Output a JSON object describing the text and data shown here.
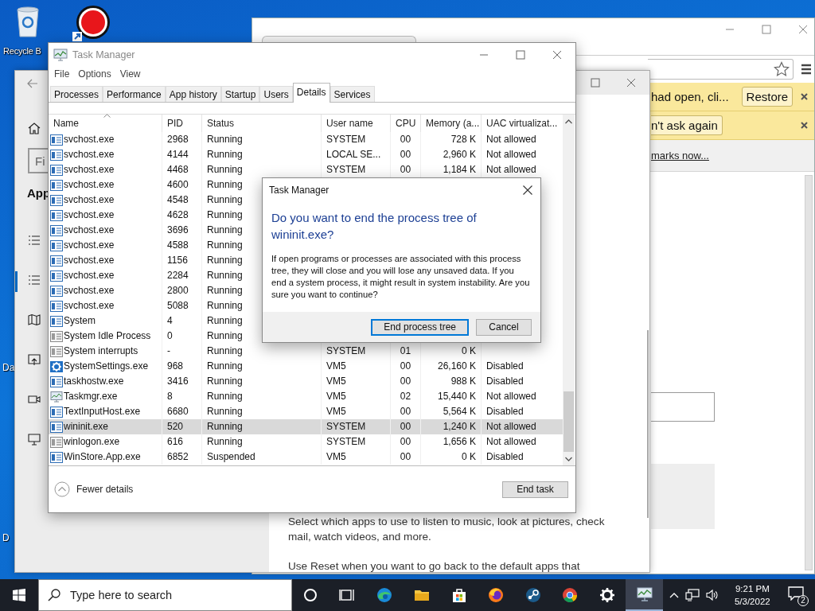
{
  "desktop": {
    "recycle_bin": {
      "label": "Recycle B"
    },
    "edge_labels": [
      "Da",
      "D"
    ]
  },
  "browser": {
    "infobars": [
      {
        "text": "had open, cli...",
        "button": "Restore"
      },
      {
        "button": "n't ask again"
      }
    ],
    "bookmark_link": "marks now..."
  },
  "settings": {
    "search": {
      "placeholder": "Fi"
    },
    "heading": "App",
    "nav": [
      {
        "kind": "list",
        "selected": false
      },
      {
        "kind": "list",
        "selected": true
      },
      {
        "kind": "map",
        "selected": false
      },
      {
        "kind": "open",
        "selected": false
      },
      {
        "kind": "video",
        "selected": false
      },
      {
        "kind": "display",
        "selected": false
      }
    ],
    "paragraphs": [
      "Select which apps to use to listen to music, look at pictures, check mail, watch videos, and more.",
      "Use Reset when you want to go back to the default apps that"
    ]
  },
  "task_manager": {
    "title": "Task Manager",
    "menu": [
      "File",
      "Options",
      "View"
    ],
    "tabs": [
      {
        "label": "Processes",
        "selected": false
      },
      {
        "label": "Performance",
        "selected": false
      },
      {
        "label": "App history",
        "selected": false
      },
      {
        "label": "Startup",
        "selected": false
      },
      {
        "label": "Users",
        "selected": false
      },
      {
        "label": "Details",
        "selected": true
      },
      {
        "label": "Services",
        "selected": false
      }
    ],
    "columns": [
      "Name",
      "PID",
      "Status",
      "User name",
      "CPU",
      "Memory (a...",
      "UAC virtualizat..."
    ],
    "rows": [
      {
        "kind": "app",
        "name": "svchost.exe",
        "pid": "2968",
        "status": "Running",
        "user": "SYSTEM",
        "cpu": "00",
        "memory": "728 K",
        "uac": "Not allowed",
        "selected": false
      },
      {
        "kind": "app",
        "name": "svchost.exe",
        "pid": "4144",
        "status": "Running",
        "user": "LOCAL SE...",
        "cpu": "00",
        "memory": "2,960 K",
        "uac": "Not allowed",
        "selected": false
      },
      {
        "kind": "app",
        "name": "svchost.exe",
        "pid": "4468",
        "status": "Running",
        "user": "SYSTEM",
        "cpu": "00",
        "memory": "1,184 K",
        "uac": "Not allowed",
        "selected": false
      },
      {
        "kind": "app",
        "name": "svchost.exe",
        "pid": "4600",
        "status": "Running",
        "selected": false
      },
      {
        "kind": "app",
        "name": "svchost.exe",
        "pid": "4548",
        "status": "Running",
        "selected": false
      },
      {
        "kind": "app",
        "name": "svchost.exe",
        "pid": "4628",
        "status": "Running",
        "selected": false
      },
      {
        "kind": "app",
        "name": "svchost.exe",
        "pid": "3696",
        "status": "Running",
        "selected": false
      },
      {
        "kind": "app",
        "name": "svchost.exe",
        "pid": "4588",
        "status": "Running",
        "selected": false
      },
      {
        "kind": "app",
        "name": "svchost.exe",
        "pid": "1156",
        "status": "Running",
        "selected": false
      },
      {
        "kind": "app",
        "name": "svchost.exe",
        "pid": "2284",
        "status": "Running",
        "selected": false
      },
      {
        "kind": "app",
        "name": "svchost.exe",
        "pid": "2800",
        "status": "Running",
        "selected": false
      },
      {
        "kind": "app",
        "name": "svchost.exe",
        "pid": "5088",
        "status": "Running",
        "selected": false
      },
      {
        "kind": "app",
        "name": "System",
        "pid": "4",
        "status": "Running",
        "selected": false
      },
      {
        "kind": "plain",
        "name": "System Idle Process",
        "pid": "0",
        "status": "Running",
        "selected": false
      },
      {
        "kind": "plain",
        "name": "System interrupts",
        "pid": "-",
        "status": "Running",
        "user": "SYSTEM",
        "cpu": "01",
        "memory": "0 K",
        "selected": false
      },
      {
        "kind": "gear",
        "name": "SystemSettings.exe",
        "pid": "968",
        "status": "Running",
        "user": "VM5",
        "cpu": "00",
        "memory": "26,160 K",
        "uac": "Disabled",
        "selected": false
      },
      {
        "kind": "app",
        "name": "taskhostw.exe",
        "pid": "3416",
        "status": "Running",
        "user": "VM5",
        "cpu": "00",
        "memory": "988 K",
        "uac": "Disabled",
        "selected": false
      },
      {
        "kind": "monitor",
        "name": "Taskmgr.exe",
        "pid": "8",
        "status": "Running",
        "user": "VM5",
        "cpu": "02",
        "memory": "15,440 K",
        "uac": "Not allowed",
        "selected": false
      },
      {
        "kind": "app",
        "name": "TextInputHost.exe",
        "pid": "6680",
        "status": "Running",
        "user": "VM5",
        "cpu": "00",
        "memory": "5,564 K",
        "uac": "Disabled",
        "selected": false
      },
      {
        "kind": "app",
        "name": "wininit.exe",
        "pid": "520",
        "status": "Running",
        "user": "SYSTEM",
        "cpu": "00",
        "memory": "1,240 K",
        "uac": "Not allowed",
        "selected": true
      },
      {
        "kind": "plain",
        "name": "winlogon.exe",
        "pid": "616",
        "status": "Running",
        "user": "SYSTEM",
        "cpu": "00",
        "memory": "1,656 K",
        "uac": "Not allowed",
        "selected": false
      },
      {
        "kind": "app",
        "name": "WinStore.App.exe",
        "pid": "6852",
        "status": "Suspended",
        "user": "VM5",
        "cpu": "00",
        "memory": "0 K",
        "uac": "Disabled",
        "selected": false
      }
    ],
    "fewer_details": "Fewer details",
    "end_task": "End task"
  },
  "dialog": {
    "title": "Task Manager",
    "heading": "Do you want to end the process tree of wininit.exe?",
    "body": "If open programs or processes are associated with this process tree, they will close and you will lose any unsaved data. If you end a system process, it might result in system instability. Are you sure you want to continue?",
    "buttons": [
      {
        "label": "End process tree",
        "default": true
      },
      {
        "label": "Cancel",
        "default": false
      }
    ]
  },
  "taskbar": {
    "search": {
      "placeholder": "Type here to search"
    },
    "apps": [
      {
        "kind": "cortana",
        "active": false
      },
      {
        "kind": "taskview",
        "active": false
      },
      {
        "kind": "edge",
        "active": false
      },
      {
        "kind": "folder",
        "active": false
      },
      {
        "kind": "store",
        "active": false
      },
      {
        "kind": "firefox",
        "active": false
      },
      {
        "kind": "steam",
        "active": false
      },
      {
        "kind": "chrome",
        "active": false
      },
      {
        "kind": "settings",
        "active": false
      },
      {
        "kind": "taskmgr",
        "active": true
      }
    ],
    "time": "9:21 PM",
    "date": "5/3/2022",
    "notifications": "2"
  }
}
